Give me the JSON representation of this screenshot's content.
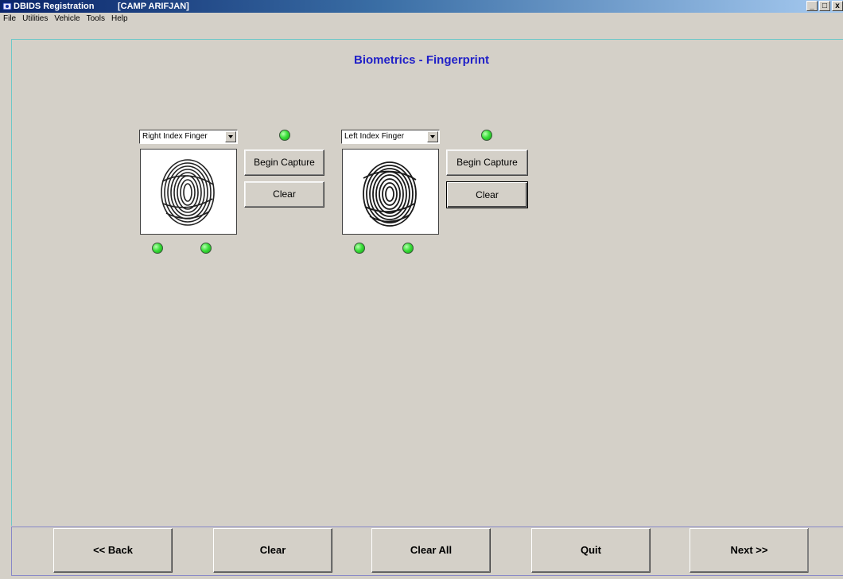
{
  "window": {
    "title": "DBIDS Registration",
    "site": "[CAMP ARIFJAN]",
    "controls": [
      "_",
      "□",
      "x"
    ]
  },
  "menu": [
    "File",
    "Utilities",
    "Vehicle",
    "Tools",
    "Help"
  ],
  "page": {
    "title": "Biometrics - Fingerprint"
  },
  "fingers": [
    {
      "selected": "Right Index Finger",
      "begin_label": "Begin Capture",
      "clear_label": "Clear"
    },
    {
      "selected": "Left Index Finger",
      "begin_label": "Begin Capture",
      "clear_label": "Clear"
    }
  ],
  "status_color": "#3ce03c",
  "nav": {
    "back": "<< Back",
    "clear": "Clear",
    "clear_all": "Clear All",
    "quit": "Quit",
    "next": "Next >>"
  }
}
